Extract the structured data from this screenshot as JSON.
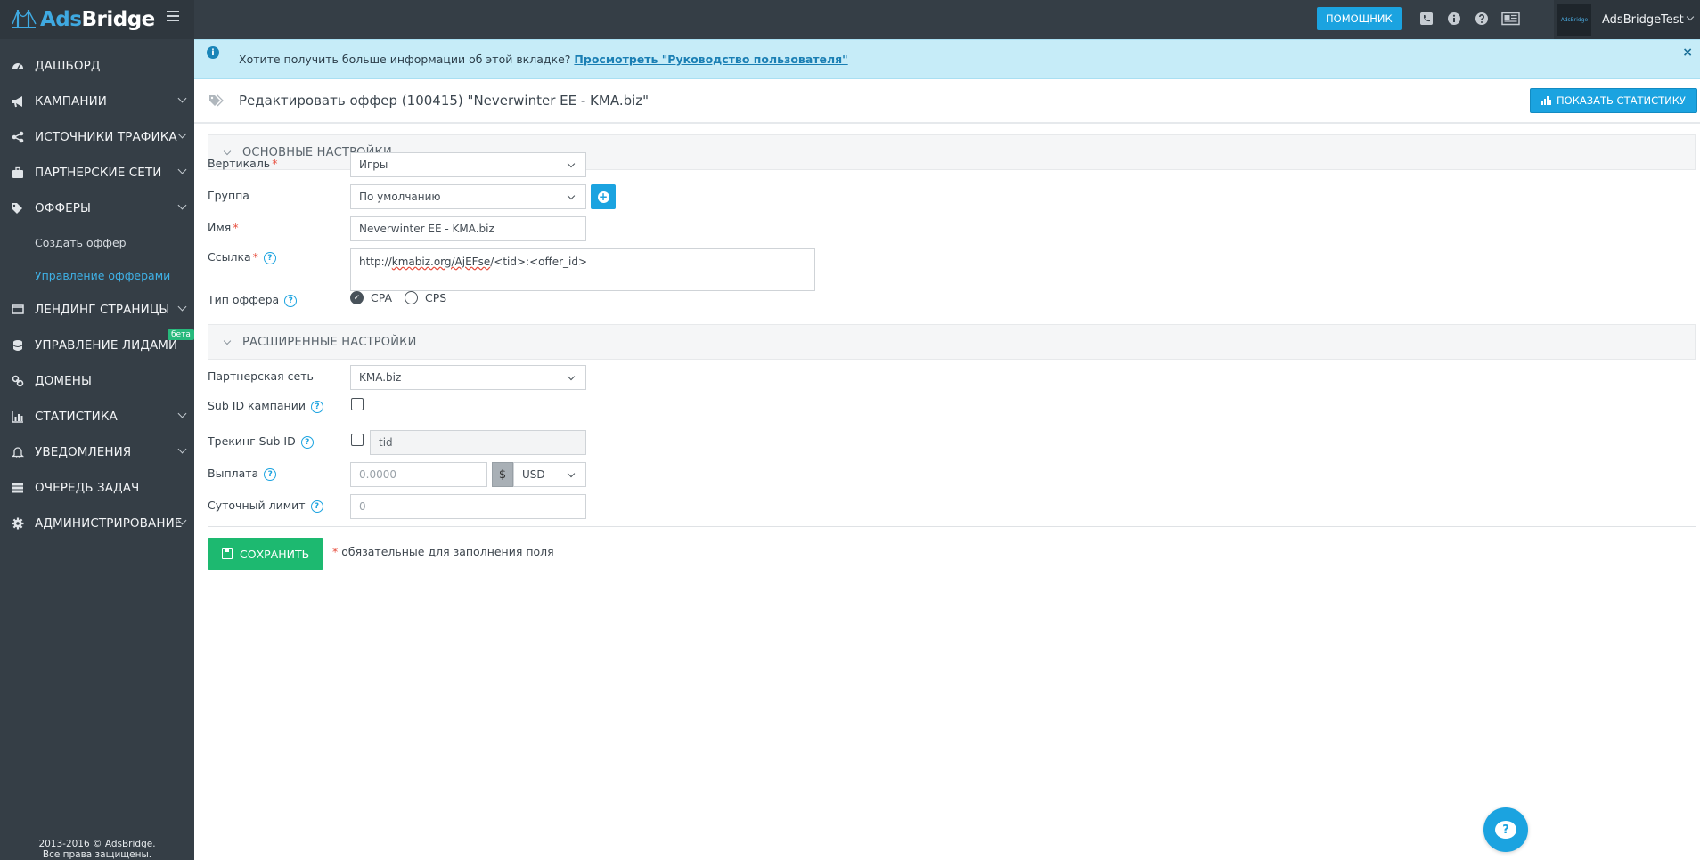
{
  "brand": {
    "logo_ads": "Ads",
    "logo_bridge": "Bridge"
  },
  "sidebar": {
    "items": [
      {
        "label": "ДАШБОРД",
        "icon": "dashboard-icon"
      },
      {
        "label": "КАМПАНИИ",
        "icon": "megaphone-icon"
      },
      {
        "label": "ИСТОЧНИКИ ТРАФИКА",
        "icon": "share-icon"
      },
      {
        "label": "ПАРТНЕРСКИЕ СЕТИ",
        "icon": "briefcase-icon"
      },
      {
        "label": "ОФФЕРЫ",
        "icon": "tags-icon"
      },
      {
        "label": "Создать оффер"
      },
      {
        "label": "Управление офферами"
      },
      {
        "label": "ЛЕНДИНГ СТРАНИЦЫ",
        "icon": "monitor-icon"
      },
      {
        "label": "УПРАВЛЕНИЕ ЛИДАМИ",
        "icon": "database-icon",
        "badge": "бета"
      },
      {
        "label": "ДОМЕНЫ",
        "icon": "link-icon"
      },
      {
        "label": "СТАТИСТИКА",
        "icon": "bar-chart-icon"
      },
      {
        "label": "УВЕДОМЛЕНИЯ",
        "icon": "bell-icon"
      },
      {
        "label": "ОЧЕРЕДЬ ЗАДАЧ",
        "icon": "server-icon"
      },
      {
        "label": "АДМИНИСТРИРОВАНИЕ",
        "icon": "gear-icon"
      }
    ],
    "copyright_line1": "2013-2016 © AdsBridge.",
    "copyright_line2": "Все права защищены."
  },
  "topbar": {
    "help_label": "ПОМОЩНИК",
    "user_name": "AdsBridgeTest",
    "avatar_text": "AdsBridge"
  },
  "info_bar": {
    "text": "Хотите получить больше информации об этой вкладке?",
    "link": "Просмотреть \"Руководство пользователя\"",
    "close": "×"
  },
  "page": {
    "title": "Редактировать оффер (100415) \"Neverwinter EE - KMA.biz\"",
    "stats_button": "ПОКАЗАТЬ СТАТИСТИКУ"
  },
  "basic_section": {
    "title": "ОСНОВНЫЕ НАСТРОЙКИ",
    "vertical_label": "Вертикаль",
    "vertical_value": "Игры",
    "group_label": "Группа",
    "group_value": "По умолчанию",
    "name_label": "Имя",
    "name_value": "Neverwinter EE - KMA.biz",
    "link_label": "Ссылка",
    "link_value_a": "http://",
    "link_value_b": "kmabiz.org/AjEFse",
    "link_value_c": "/<tid>:<offer_id>",
    "offer_type_label": "Тип оффера",
    "type_cpa": "CPA",
    "type_cps": "CPS",
    "required_mark": "*",
    "q": "?"
  },
  "advanced_section": {
    "title": "РАСШИРЕННЫЕ НАСТРОЙКИ",
    "network_label": "Партнерская сеть",
    "network_value": "KMA.biz",
    "subid_label": "Sub ID кампании",
    "tracking_label": "Трекинг Sub ID",
    "tracking_value": "tid",
    "payout_label": "Выплата",
    "payout_placeholder": "0.0000",
    "currency_symbol": "$",
    "currency_value": "USD",
    "limit_label": "Суточный лимит",
    "limit_placeholder": "0"
  },
  "footer": {
    "save_label": "СОХРАНИТЬ",
    "required_note": "обязательные для заполнения поля"
  }
}
